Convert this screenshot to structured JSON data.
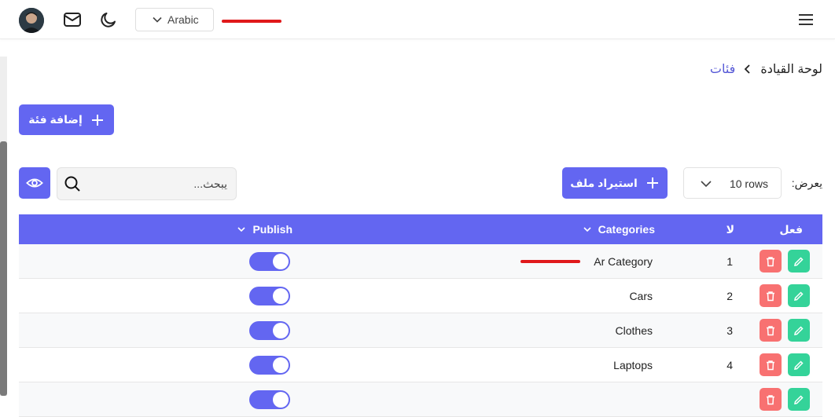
{
  "header": {
    "language": "Arabic",
    "icons": [
      "avatar",
      "mail-icon",
      "moon-icon",
      "chevron-down-icon",
      "menu-icon"
    ]
  },
  "breadcrumb": {
    "home": "لوحة القيادة",
    "current": "فئات"
  },
  "toolbar": {
    "add_label": "إضافة فئة",
    "import_label": "استيراد ملف",
    "rows_value": "10 rows",
    "show_label": "يعرض:",
    "search_placeholder": "يبحث..."
  },
  "table": {
    "columns": {
      "actions": "فعل",
      "num": "لا",
      "categories": "Categories",
      "publish": "Publish"
    },
    "rows": [
      {
        "num": "1",
        "category": "Ar Category",
        "published": true
      },
      {
        "num": "2",
        "category": "Cars",
        "published": true
      },
      {
        "num": "3",
        "category": "Clothes",
        "published": true
      },
      {
        "num": "4",
        "category": "Laptops",
        "published": true
      },
      {
        "num": "",
        "category": "",
        "published": true
      }
    ]
  },
  "colors": {
    "accent": "#6366f1",
    "delete": "#f87171",
    "edit": "#34d399",
    "redaction": "#e0191b"
  }
}
